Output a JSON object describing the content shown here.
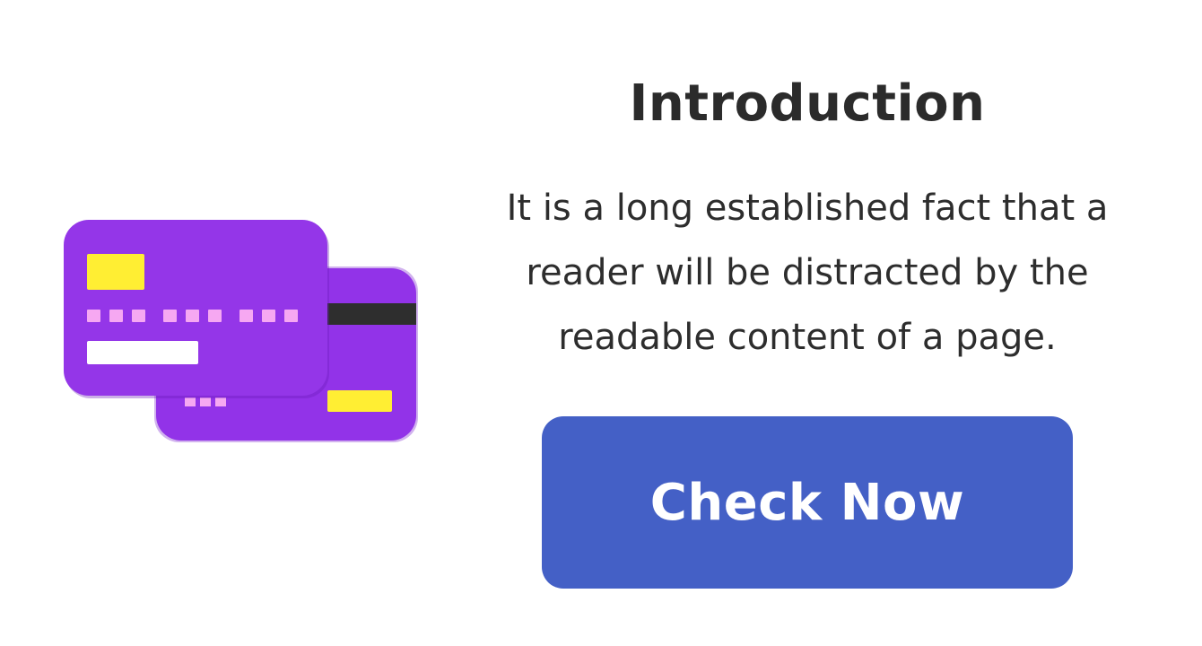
{
  "intro": {
    "title": "Introduction",
    "description": "It is a long established fact that a reader will be distracted by the readable content of a page."
  },
  "cta": {
    "label": "Check Now"
  },
  "illustration": {
    "icon": "credit-cards-icon",
    "colors": {
      "card": "#9436e8",
      "card_back": "#8d2fe0",
      "chip": "#ffee33",
      "digits": "#f6a8f2",
      "stripe": "#2e2e2e",
      "name_bar": "#ffffff"
    }
  },
  "theme": {
    "background": "#ffffff",
    "text": "#2d2d2d",
    "button_bg": "#4460c6",
    "button_text": "#ffffff"
  }
}
